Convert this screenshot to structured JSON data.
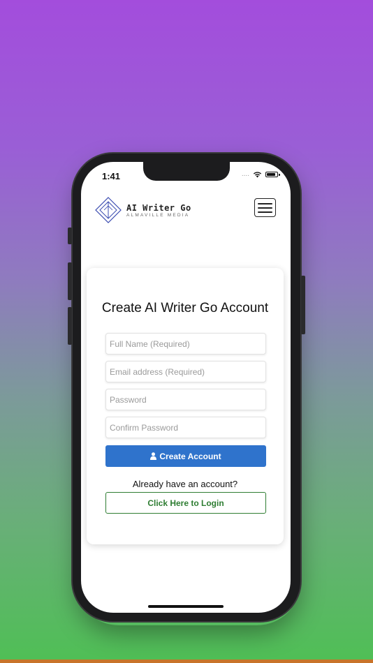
{
  "status_bar": {
    "time": "1:41",
    "signal": "....",
    "icons": [
      "wifi-icon",
      "battery-icon"
    ]
  },
  "header": {
    "logo_title": "AI Writer Go",
    "logo_subtitle": "ALMAVILLE MEDIA",
    "logo_icon": "diamond-logo-icon",
    "menu_icon": "hamburger-menu-icon"
  },
  "form": {
    "title": "Create AI Writer Go Account",
    "full_name_placeholder": "Full Name (Required)",
    "email_placeholder": "Email address (Required)",
    "password_placeholder": "Password",
    "confirm_password_placeholder": "Confirm Password",
    "create_button_label": "Create Account",
    "create_button_icon": "user-icon",
    "already_text": "Already have an account?",
    "login_button_label": "Click Here to Login"
  },
  "colors": {
    "primary_blue": "#2f73cc",
    "login_green": "#2e7d32",
    "logo_blue": "#3a4bb0",
    "background_top": "#a34ddc",
    "background_bottom": "#4fbf55"
  }
}
